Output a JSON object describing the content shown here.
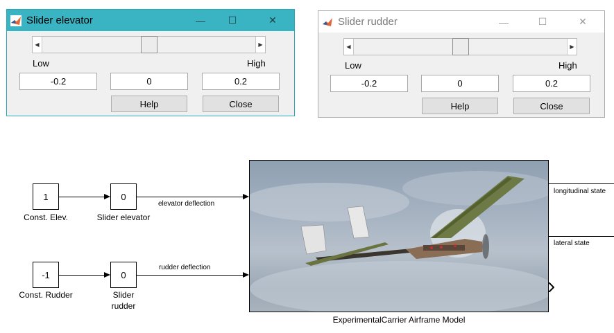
{
  "windows": {
    "elevator": {
      "title": "Slider elevator",
      "state": "active",
      "slider_value_fraction": 0.5,
      "labels": {
        "low": "Low",
        "high": "High"
      },
      "fields": {
        "min": "-0.2",
        "value": "0",
        "max": "0.2"
      },
      "buttons": {
        "help": "Help",
        "close": "Close"
      }
    },
    "rudder": {
      "title": "Slider rudder",
      "state": "inactive",
      "slider_value_fraction": 0.5,
      "labels": {
        "low": "Low",
        "high": "High"
      },
      "fields": {
        "min": "-0.2",
        "value": "0",
        "max": "0.2"
      },
      "buttons": {
        "help": "Help",
        "close": "Close"
      }
    },
    "titlebar_glyphs": {
      "minimize": "—",
      "maximize": "☐",
      "close": "✕"
    }
  },
  "diagram": {
    "blocks": {
      "const_elev": {
        "value": "1",
        "label": "Const. Elev."
      },
      "slider_elev": {
        "value": "0",
        "label": "Slider elevator"
      },
      "const_rudder": {
        "value": "-1",
        "label": "Const. Rudder"
      },
      "slider_rudder": {
        "value": "0",
        "label_line1": "Slider",
        "label_line2": "rudder"
      }
    },
    "signals": {
      "elevator": "elevator deflection",
      "rudder": "rudder deflection",
      "longitudinal": "longitudinal state",
      "lateral": "lateral state"
    },
    "model_label": "ExperimentalCarrier Airframe Model"
  },
  "colors": {
    "active_titlebar": "#3ab4c2",
    "window_bg": "#f0f0f0",
    "matlab_logo_orange": "#e16737",
    "matlab_logo_blue": "#2a5e9e"
  }
}
